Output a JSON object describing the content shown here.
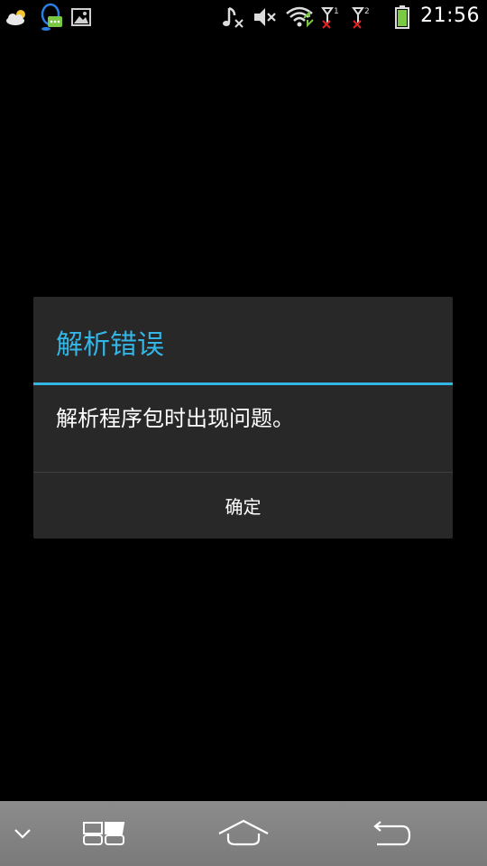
{
  "status_bar": {
    "time": "21:56",
    "left_icons": [
      "weather-cloud-sun-icon",
      "qq-penguin-message-icon",
      "gallery-image-icon"
    ],
    "right_icons": [
      "music-muted-icon",
      "volume-muted-icon",
      "wifi-icon",
      "signal-sim1-no-service-icon",
      "signal-sim2-no-service-icon",
      "battery-charging-icon"
    ],
    "sim1_label": "1",
    "sim2_label": "2"
  },
  "dialog": {
    "title": "解析错误",
    "message": "解析程序包时出现问题。",
    "ok_label": "确定",
    "accent_color": "#33b5e5"
  },
  "nav_bar": {
    "buttons": [
      "collapse-chevron-icon",
      "recent-apps-icon",
      "home-icon",
      "back-icon"
    ]
  }
}
